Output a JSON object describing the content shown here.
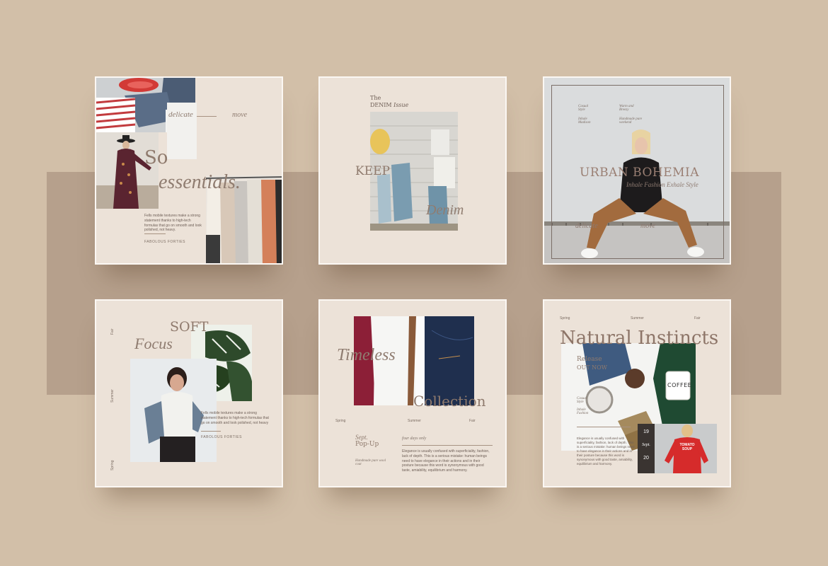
{
  "cards": [
    {
      "title_line1": "So",
      "title_line2": "essentials.",
      "word_left": "delicate",
      "word_right": "move",
      "body": "Fells mobile textures make a strong statement thanks to high-tech formulas that go on smooth and look polished, not heavy.",
      "footer": "FABOLOUS FORTIES"
    },
    {
      "issue_line1": "The",
      "issue_line2_a": "DENIM",
      "issue_line2_b": "Issue",
      "word_keep": "KEEP",
      "word_denim": "Denim"
    },
    {
      "notes_left": [
        "Casual",
        "Style",
        "Inhale",
        "Madison"
      ],
      "notes_right": [
        "Warm and",
        "Breezy",
        "Handmade pure",
        "weekend"
      ],
      "title": "URBAN BOHEMIA",
      "subtitle": "Inhale Fashion Exhale Style",
      "word_left": "delicate",
      "word_right": "move"
    },
    {
      "title_line1": "SOFT",
      "title_line2": "Focus",
      "side_labels": [
        "Fair",
        "Summer",
        "Spring"
      ],
      "body": "Fells mobile textures make a strong statement thanks to high-tech formulas that go on smooth and look polished, not heavy",
      "footer": "FABOLOUS FORTIES"
    },
    {
      "title_line1": "Timeless",
      "title_line2": "Collection",
      "seasons": [
        "Spring",
        "Summer",
        "Fair"
      ],
      "date_line1": "Sept.",
      "date_line2": "Pop-Up",
      "handmade": "Handmade pure wool coat",
      "four_days": "four days only",
      "body": "Elegance is usually confused with superficiality, fashion, lack of depth. This is a serious mistake: human beings need to have elegance in their actions and in their posture because this word is synonymous with good taste, amiability, equilibrium and harmony."
    },
    {
      "seasons": [
        "Spring",
        "Summer",
        "Fair"
      ],
      "title": "Natural Instincts",
      "release_line1": "Release",
      "release_line2": "OUT NOW",
      "notes": [
        "Casual",
        "Style",
        "Inhale",
        "Fashion"
      ],
      "mug_text": "COFFEE",
      "date_top": "19",
      "date_mid": "Sept.",
      "date_bottom": "20",
      "sweater_text": "TOMATO SOUP",
      "body": "Elegance is usually confused with superficiality, fashion, lack of depth. This is a serious mistake: human beings need to have elegance in their actions and in their posture because this word is synonymous with good taste, amiability, equilibrium and harmony."
    }
  ]
}
